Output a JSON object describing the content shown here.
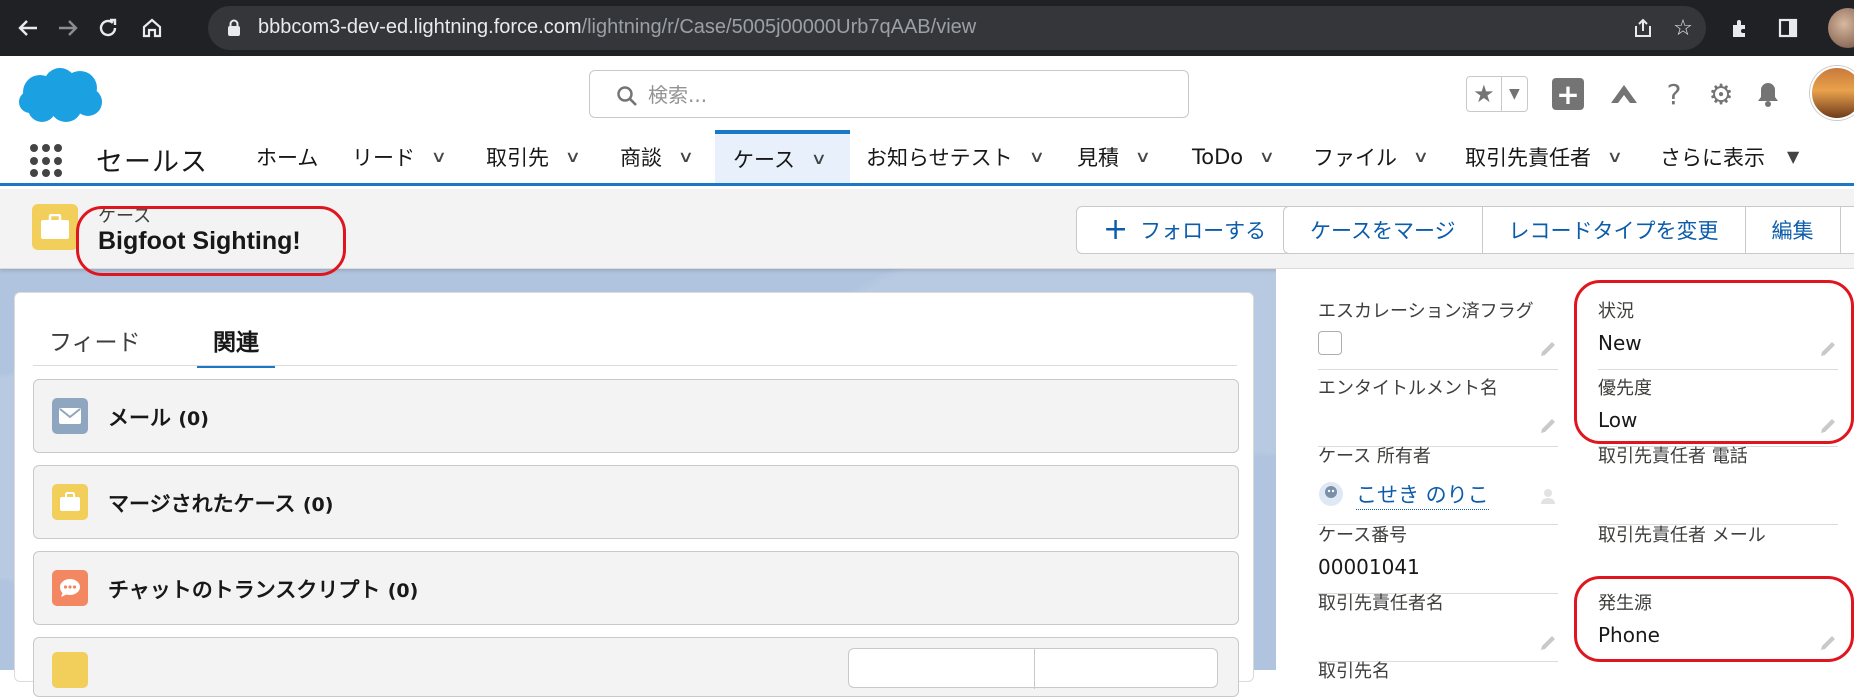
{
  "browser": {
    "url_host": "bbbcom3-dev-ed.lightning.force.com",
    "url_path": "/lightning/r/Case/5005j00000Urb7qAAB/view"
  },
  "header": {
    "search_placeholder": "検索..."
  },
  "nav": {
    "app_name": "セールス",
    "items": [
      {
        "label": "ホーム"
      },
      {
        "label": "リード"
      },
      {
        "label": "取引先"
      },
      {
        "label": "商談"
      },
      {
        "label": "ケース"
      },
      {
        "label": "お知らせテスト"
      },
      {
        "label": "見積"
      },
      {
        "label": "ToDo"
      },
      {
        "label": "ファイル"
      },
      {
        "label": "取引先責任者"
      },
      {
        "label": "さらに表示"
      }
    ],
    "active": "ケース"
  },
  "record": {
    "object_label": "ケース",
    "title": "Bigfoot Sighting!",
    "actions": {
      "follow": "フォローする",
      "merge": "ケースをマージ",
      "change_type": "レコードタイプを変更",
      "edit": "編集"
    }
  },
  "tabs": {
    "feed": "フィード",
    "related": "関連"
  },
  "related_lists": [
    {
      "title": "メール",
      "count": "(0)"
    },
    {
      "title": "マージされたケース",
      "count": "(0)"
    },
    {
      "title": "チャットのトランスクリプト",
      "count": "(0)"
    }
  ],
  "details": {
    "escalated_label": "エスカレーション済フラグ",
    "status_label": "状況",
    "status_value": "New",
    "entitlement_label": "エンタイトルメント名",
    "priority_label": "優先度",
    "priority_value": "Low",
    "owner_label": "ケース 所有者",
    "owner_value": "こせき のりこ",
    "contact_phone_label": "取引先責任者 電話",
    "case_number_label": "ケース番号",
    "case_number_value": "00001041",
    "contact_email_label": "取引先責任者 メール",
    "contact_name_label": "取引先責任者名",
    "origin_label": "発生源",
    "origin_value": "Phone",
    "account_name_label": "取引先名"
  },
  "colors": {
    "brand_blue": "#1b78c6",
    "link_blue": "#0b5cab",
    "annotation_red": "#e0161e",
    "case_yellow": "#f2cf5b"
  }
}
